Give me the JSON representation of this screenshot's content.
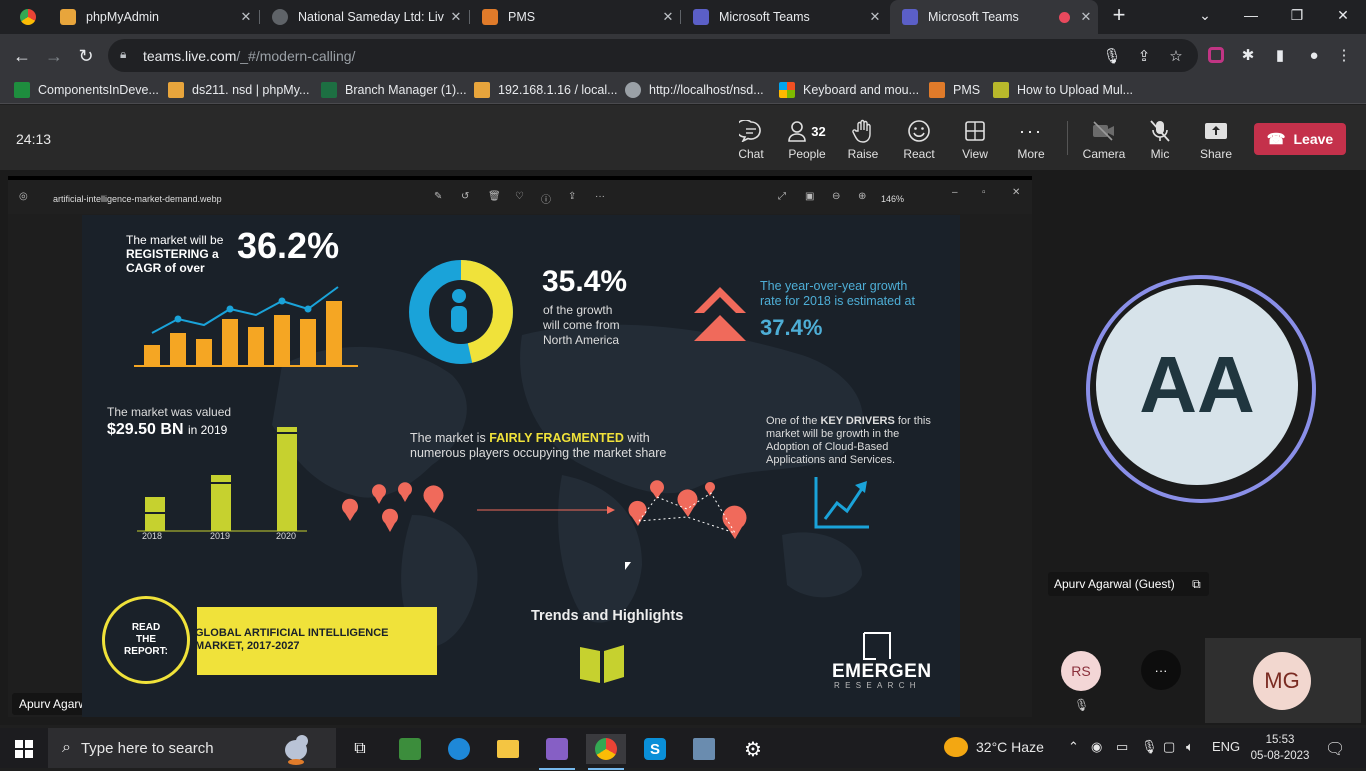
{
  "browser": {
    "tabs": [
      {
        "title": "phpMyAdmin",
        "icon": "phpmyadmin-icon",
        "color": "#e8a53c"
      },
      {
        "title": "National Sameday Ltd: Live",
        "icon": "globe-icon",
        "color": "#9aa0a6"
      },
      {
        "title": "PMS",
        "icon": "grid-icon",
        "color": "#e07b2a"
      },
      {
        "title": "Microsoft Teams",
        "icon": "teams-icon",
        "color": "#5b5fc7"
      },
      {
        "title": "Microsoft Teams",
        "icon": "teams-icon",
        "color": "#5b5fc7"
      }
    ],
    "url_host": "teams.live.com",
    "url_path": "/_#/modern-calling/",
    "bookmarks": [
      {
        "label": "ComponentsInDeve...",
        "icon": "sheets-icon",
        "color": "#1e8e3e"
      },
      {
        "label": "ds211. nsd | phpMy...",
        "icon": "phpmyadmin-icon",
        "color": "#e8a53c"
      },
      {
        "label": "Branch Manager (1)...",
        "icon": "excel-icon",
        "color": "#1d6f42"
      },
      {
        "label": "192.168.1.16 / local...",
        "icon": "phpmyadmin-icon",
        "color": "#e8a53c"
      },
      {
        "label": "http://localhost/nsd...",
        "icon": "globe-icon",
        "color": "#9aa0a6"
      },
      {
        "label": "Keyboard and mou...",
        "icon": "microsoft-icon",
        "color": "#f25022"
      },
      {
        "label": "PMS",
        "icon": "grid-icon",
        "color": "#e07b2a"
      },
      {
        "label": "How to Upload Mul...",
        "icon": "y-icon",
        "color": "#b8b82b"
      }
    ]
  },
  "teams": {
    "timer": "24:13",
    "buttons": [
      {
        "label": "Chat",
        "icon": "chat-icon"
      },
      {
        "label": "People",
        "icon": "people-icon",
        "count": "32"
      },
      {
        "label": "Raise",
        "icon": "hand-icon"
      },
      {
        "label": "React",
        "icon": "smile-icon"
      },
      {
        "label": "View",
        "icon": "view-icon"
      },
      {
        "label": "More",
        "icon": "more-icon"
      },
      {
        "label": "Camera",
        "icon": "camera-off-icon"
      },
      {
        "label": "Mic",
        "icon": "mic-off-icon"
      },
      {
        "label": "Share",
        "icon": "share-icon"
      }
    ],
    "leave_label": "Leave",
    "leave_color": "#c4314b",
    "presenter_name": "Apurv Agarwal (Guest)",
    "main_avatar": "AA",
    "participant_name": "Apurv Agarwal (Guest)",
    "small_avatars": [
      "RS",
      "MG"
    ],
    "more_label": "···"
  },
  "viewer": {
    "filename": "artificial-intelligence-market-demand.webp",
    "zoom": "146%"
  },
  "infographic": {
    "cagr_line1": "The market will be",
    "cagr_line2": "REGISTERING a",
    "cagr_line3": "CAGR of over",
    "cagr_value": "36.2%",
    "na_value": "35.4%",
    "na_line1": "of the growth",
    "na_line2": "will come from",
    "na_line3": "North America",
    "yoy_line1": "The year-over-year growth",
    "yoy_line2": "rate for 2018 is estimated at",
    "yoy_value": "37.4%",
    "valued_line1": "The market was valued",
    "valued_value": "$29.50 BN",
    "valued_year": "in 2019",
    "years": [
      "2018",
      "2019",
      "2020"
    ],
    "frag_pre": "The market is ",
    "frag_hl": "FAIRLY FRAGMENTED",
    "frag_post": " with",
    "frag_line2": "numerous players occupying the market share",
    "drivers_pre": "One of the ",
    "drivers_hl": "KEY DRIVERS",
    "drivers_post": " for this",
    "drivers_line2": "market will be growth in the",
    "drivers_line3": "Adoption of Cloud-Based",
    "drivers_line4": "Applications and Services.",
    "read_line1": "READ",
    "read_line2": "THE",
    "read_line3": "REPORT:",
    "report_line1": "GLOBAL ARTIFICIAL INTELLIGENCE",
    "report_line2": "MARKET, 2017-2027",
    "trends": "Trends and Highlights",
    "brand": "EMERGEN",
    "brand_sub": "RESEARCH",
    "colors": {
      "orange": "#f5a623",
      "lime": "#c6d12f",
      "cyan": "#1aa3d9",
      "coral": "#f06a5b",
      "yellow": "#f0e23a"
    }
  },
  "taskbar": {
    "search_placeholder": "Type here to search",
    "weather": "32°C  Haze",
    "lang": "ENG",
    "time": "15:53",
    "date": "05-08-2023",
    "apps": [
      "task-view-icon",
      "app-icon",
      "edge-icon",
      "explorer-icon",
      "visual-studio-icon",
      "chrome-icon",
      "skype-icon",
      "app2-icon",
      "settings-icon"
    ]
  }
}
